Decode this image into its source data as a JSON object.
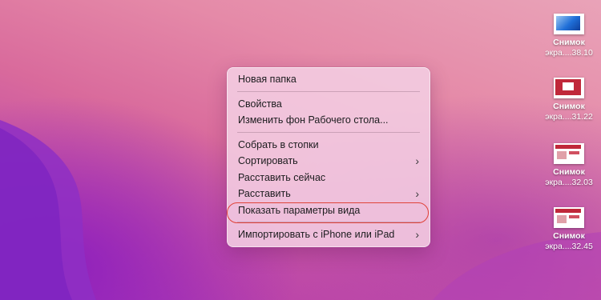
{
  "menu": {
    "items": [
      {
        "label": "Новая папка"
      },
      {
        "label": "Свойства"
      },
      {
        "label": "Изменить фон Рабочего стола..."
      },
      {
        "label": "Собрать в стопки"
      },
      {
        "label": "Сортировать",
        "submenu": true
      },
      {
        "label": "Расставить сейчас"
      },
      {
        "label": "Расставить",
        "submenu": true
      },
      {
        "label": "Показать параметры вида",
        "highlighted": true
      },
      {
        "label": "Импортировать с iPhone или iPad",
        "submenu": true
      }
    ],
    "submenu_glyph": "›"
  },
  "desktop_icons": [
    {
      "name": "Снимок",
      "sub": "экра....38.10",
      "thumb": "blue-swirl"
    },
    {
      "name": "Снимок",
      "sub": "экра....31.22",
      "thumb": "red-window"
    },
    {
      "name": "Снимок",
      "sub": "экра....32.03",
      "thumb": "red-ui"
    },
    {
      "name": "Снимок",
      "sub": "экра....32.45",
      "thumb": "red-ui"
    }
  ],
  "colors": {
    "highlight_outline": "#e0443a",
    "wallpaper": "#d96a9c"
  }
}
